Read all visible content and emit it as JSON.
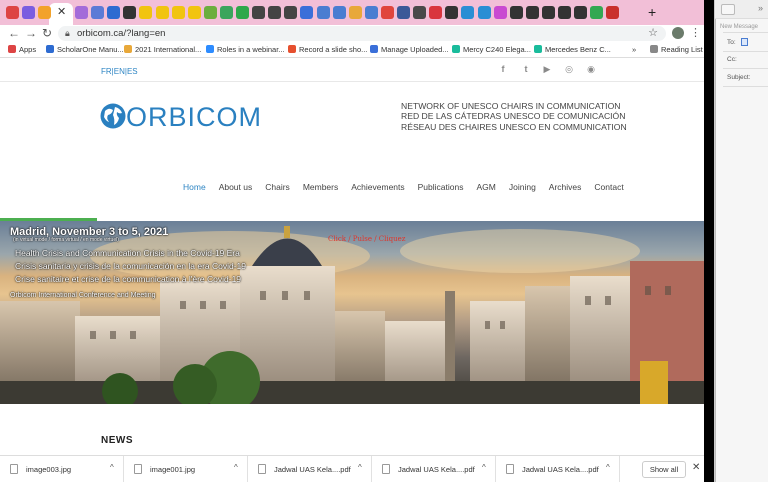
{
  "browser": {
    "url": "orbicom.ca/?lang=en",
    "tab_colors": [
      "#d44",
      "#7a5ce0",
      "#f2a22b",
      "#ffffff",
      "#a36bd9",
      "#5c7bd6",
      "#2d6bd1",
      "#333333",
      "#f1c40f",
      "#f1c40f",
      "#f1c40f",
      "#f1c40f",
      "#6cae3e",
      "#3ba55c",
      "#2ea84a",
      "#444444",
      "#444444",
      "#444444",
      "#3a6fd9",
      "#4a7dd1",
      "#4a7dd1",
      "#e8a83a",
      "#4a7dd1",
      "#e0453c",
      "#3b5998",
      "#4a4a4a",
      "#d9363e",
      "#333333",
      "#2a8ed4",
      "#2a8ed4",
      "#c94ad1",
      "#333333",
      "#333333",
      "#333333",
      "#333333",
      "#333333",
      "#33a852",
      "#c9302c"
    ],
    "new_tab": "+",
    "bookmarks": [
      {
        "label": "Apps",
        "color": "#d44"
      },
      {
        "label": "ScholarOne Manu...",
        "color": "#2d6bd1"
      },
      {
        "label": "2021 International...",
        "color": "#e8a83a"
      },
      {
        "label": "Roles in a webinar...",
        "color": "#2d8cff"
      },
      {
        "label": "Record a slide sho...",
        "color": "#e6502f"
      },
      {
        "label": "Manage Uploaded...",
        "color": "#3a6fd9"
      },
      {
        "label": "Mercy C240 Elega...",
        "color": "#1abc9c"
      },
      {
        "label": "Mercedes Benz C...",
        "color": "#1abc9c"
      }
    ],
    "more_bookmarks": "»",
    "reading_list": "Reading List"
  },
  "site": {
    "lang": [
      "FR",
      "EN",
      "ES"
    ],
    "lang_sep": "|",
    "social_icons": [
      "facebook-icon",
      "twitter-icon",
      "youtube-icon",
      "instagram-icon",
      "rss-icon"
    ],
    "social_glyphs": [
      "f",
      "t",
      "▶",
      "◎",
      "◉"
    ],
    "logo_text": "ORBICOM",
    "network_lines": [
      "NETWORK OF UNESCO CHAIRS IN COMMUNICATION",
      "RED DE LAS CÁTEDRAS UNESCO DE COMUNICACIÓN",
      "RÉSEAU DES CHAIRES UNESCO EN COMMUNICATION"
    ],
    "menu": [
      "Home",
      "About us",
      "Chairs",
      "Members",
      "Achievements",
      "Publications",
      "AGM",
      "Joining",
      "Archives",
      "Contact"
    ],
    "active_menu": "Home",
    "hero": {
      "headline": "Madrid, November 3 to 5, 2021",
      "mode": "(in virtual mode / forma virtual / en mode virtuel)",
      "click": "Click / Pulse / Cliquez",
      "lines": [
        "Health Crisis and Communication Crisis in the Covid-19 Era",
        "Crisis sanitaria y crisis de la comunicación en la era Covid-19",
        "Crise sanitaire et crise de la communication à l'ère Covid-19"
      ],
      "event": "Orbicom International Conference and Meeting"
    },
    "news_heading": "NEWS"
  },
  "downloads": {
    "items": [
      "image003.jpg",
      "image001.jpg",
      "Jadwal UAS Kela....pdf",
      "Jadwal UAS Kela....pdf",
      "Jadwal UAS Kela....pdf"
    ],
    "show_all": "Show all",
    "chevron": "^",
    "close": "✕"
  },
  "mail": {
    "title": "New Message",
    "to_label": "To:",
    "cc_label": "Cc:",
    "subject_label": "Subject:",
    "collapse": "»"
  }
}
